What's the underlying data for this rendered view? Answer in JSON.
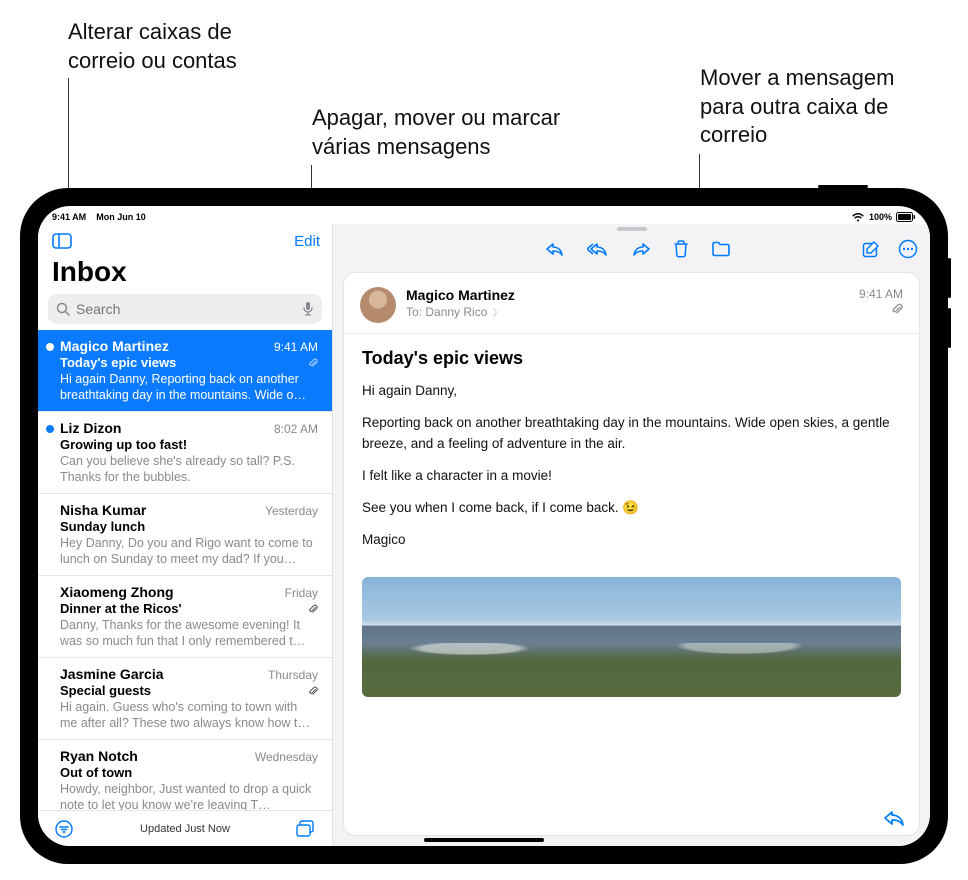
{
  "callouts": {
    "mailboxes": "Alterar caixas de\ncorreio ou contas",
    "edit": "Apagar, mover ou marcar\nvárias mensagens",
    "move": "Mover a mensagem\npara outra caixa de\ncorreio"
  },
  "statusbar": {
    "time": "9:41 AM",
    "date": "Mon Jun 10",
    "battery": "100%"
  },
  "sidebar": {
    "edit_label": "Edit",
    "title": "Inbox",
    "search_placeholder": "Search",
    "status": "Updated Just Now"
  },
  "messages": [
    {
      "sender": "Magico Martinez",
      "time": "9:41 AM",
      "subject": "Today's epic views",
      "preview": "Hi again Danny, Reporting back on another breathtaking day in the mountains. Wide o…",
      "unread": true,
      "attachment": true,
      "selected": true
    },
    {
      "sender": "Liz Dizon",
      "time": "8:02 AM",
      "subject": "Growing up too fast!",
      "preview": "Can you believe she's already so tall? P.S. Thanks for the bubbles.",
      "unread": true,
      "attachment": false,
      "selected": false
    },
    {
      "sender": "Nisha Kumar",
      "time": "Yesterday",
      "subject": "Sunday lunch",
      "preview": "Hey Danny, Do you and Rigo want to come to lunch on Sunday to meet my dad? If you…",
      "unread": false,
      "attachment": false,
      "selected": false
    },
    {
      "sender": "Xiaomeng Zhong",
      "time": "Friday",
      "subject": "Dinner at the Ricos'",
      "preview": "Danny, Thanks for the awesome evening! It was so much fun that I only remembered t…",
      "unread": false,
      "attachment": true,
      "selected": false
    },
    {
      "sender": "Jasmine Garcia",
      "time": "Thursday",
      "subject": "Special guests",
      "preview": "Hi again. Guess who's coming to town with me after all? These two always know how t…",
      "unread": false,
      "attachment": true,
      "selected": false
    },
    {
      "sender": "Ryan Notch",
      "time": "Wednesday",
      "subject": "Out of town",
      "preview": "Howdy, neighbor, Just wanted to drop a quick note to let you know we're leaving T…",
      "unread": false,
      "attachment": false,
      "selected": false
    }
  ],
  "detail": {
    "from": "Magico Martinez",
    "to_label": "To:",
    "to_name": "Danny Rico",
    "time": "9:41 AM",
    "subject": "Today's epic views",
    "body": [
      "Hi again Danny,",
      "Reporting back on another breathtaking day in the mountains. Wide open skies, a gentle breeze, and a feeling of adventure in the air.",
      "I felt like a character in a movie!",
      "See you when I come back, if I come back. 😉",
      "Magico"
    ]
  }
}
